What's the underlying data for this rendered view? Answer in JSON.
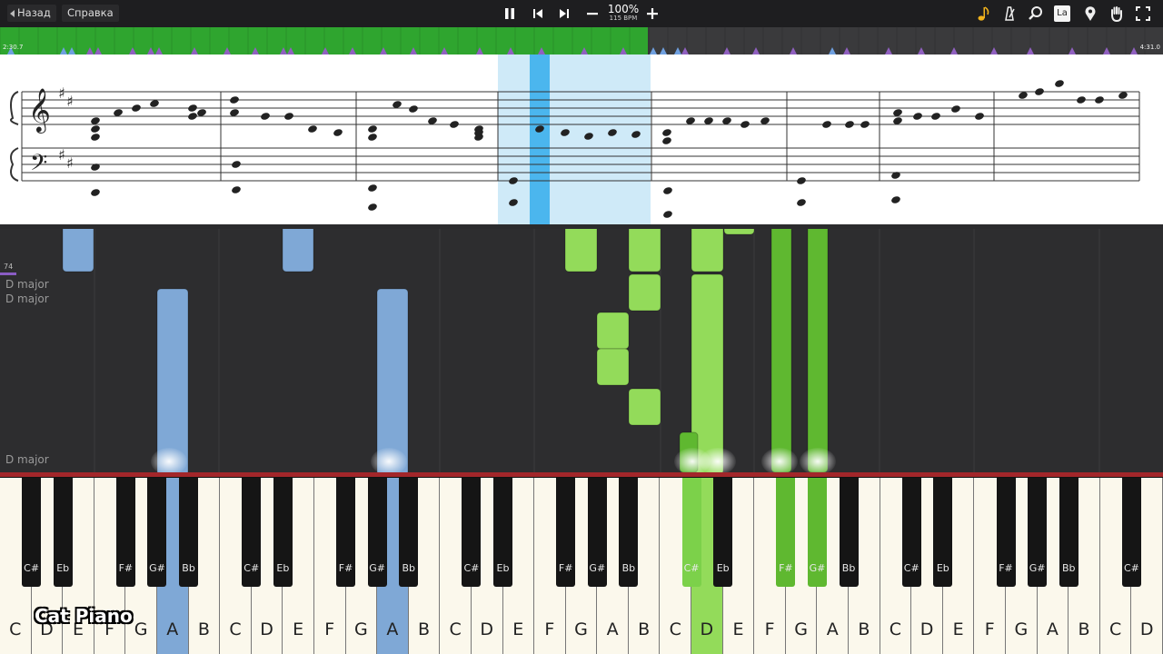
{
  "toolbar": {
    "back_label": "Назад",
    "help_label": "Справка",
    "tempo_percent": "100%",
    "tempo_bpm": "115 BPM"
  },
  "timeline": {
    "current_time": "2:30.7",
    "total_time": "4:31.0",
    "progress": 0.557
  },
  "key_signature_labels": [
    "D major",
    "D major",
    "D major"
  ],
  "measure_marker": "74",
  "logo_text": "Cat Piano",
  "keyboard": {
    "white_labels": [
      "C",
      "D",
      "E",
      "F",
      "G",
      "A",
      "B",
      "C",
      "D",
      "E",
      "F",
      "G",
      "A",
      "B",
      "C",
      "D",
      "E",
      "F",
      "G",
      "A",
      "B",
      "C",
      "D",
      "E",
      "F",
      "G",
      "A",
      "B",
      "C",
      "D",
      "E",
      "F",
      "G",
      "A",
      "B",
      "C",
      "D"
    ],
    "black_labels": [
      "C#",
      "Eb",
      "F#",
      "G#",
      "Bb",
      "C#",
      "Eb",
      "F#",
      "G#",
      "Bb",
      "C#",
      "Eb",
      "F#",
      "G#",
      "Bb",
      "C#",
      "Eb",
      "F#",
      "G#",
      "Bb",
      "C#",
      "Eb",
      "F#",
      "G#",
      "Bb",
      "C#"
    ],
    "pressed_white": {
      "5": "#7fa8d6",
      "12": "#7fa8d6",
      "22": "#93db5a"
    },
    "pressed_black": {
      "15": "#7cd14a",
      "17": "#5fb830",
      "18": "#5fb830"
    }
  },
  "icons": {
    "note": "eighth-note-icon",
    "metronome": "metronome-icon",
    "zoom": "magnifier-icon",
    "label": "La",
    "marker": "location-pin-icon",
    "hand": "hand-icon",
    "fullscreen": "fullscreen-icon"
  },
  "colors": {
    "left_hand": "#7fa8d6",
    "right_hand": "#93db5a",
    "right_hand_dark": "#5fb830",
    "progress": "#2fa52f",
    "sheet_highlight": "#cfeaf8",
    "sheet_cursor": "#4bb6ee"
  }
}
